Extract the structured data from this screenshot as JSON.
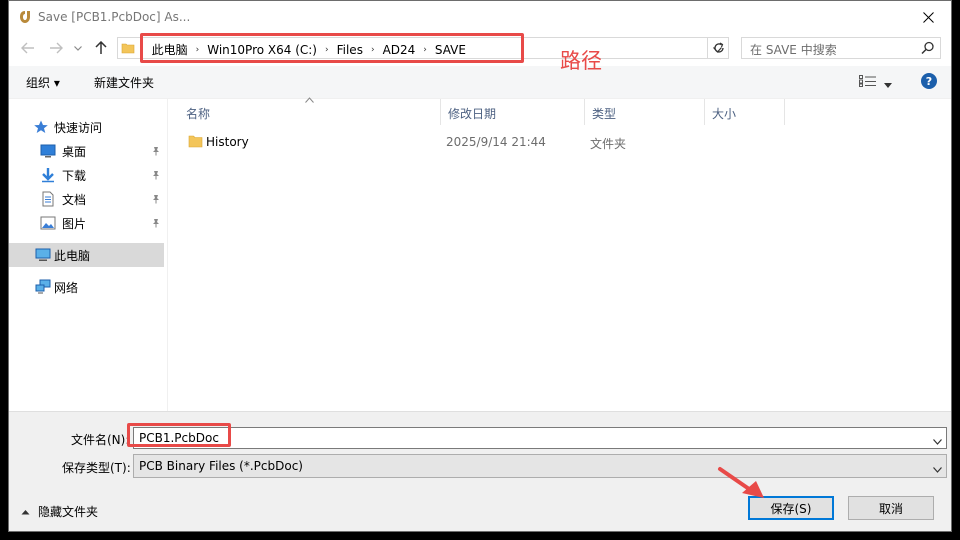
{
  "window": {
    "title": "Save [PCB1.PcbDoc] As..."
  },
  "address_bar": {
    "crumbs": [
      "此电脑",
      "Win10Pro X64 (C:)",
      "Files",
      "AD24",
      "SAVE"
    ]
  },
  "search": {
    "placeholder": "在 SAVE 中搜索"
  },
  "annotation": {
    "path_label": "路径"
  },
  "toolbar": {
    "organize_label": "组织 ▾",
    "new_folder_label": "新建文件夹"
  },
  "sidebar": {
    "items": [
      {
        "label": "快速访问",
        "icon": "star-icon"
      },
      {
        "label": "桌面",
        "icon": "desktop-icon",
        "pinned": true
      },
      {
        "label": "下载",
        "icon": "download-icon",
        "pinned": true
      },
      {
        "label": "文档",
        "icon": "document-icon",
        "pinned": true
      },
      {
        "label": "图片",
        "icon": "pictures-icon",
        "pinned": true
      },
      {
        "label": "此电脑",
        "icon": "computer-icon",
        "selected": true
      },
      {
        "label": "网络",
        "icon": "network-icon"
      }
    ]
  },
  "columns": {
    "name": "名称",
    "date": "修改日期",
    "type": "类型",
    "size": "大小"
  },
  "files": [
    {
      "name": "History",
      "date": "2025/9/14 21:44",
      "type": "文件夹",
      "size": ""
    }
  ],
  "form": {
    "filename_label": "文件名(N):",
    "filename_value": "PCB1.PcbDoc",
    "filetype_label": "保存类型(T):",
    "filetype_value": "PCB Binary Files (*.PcbDoc)",
    "hide_folders_label": "隐藏文件夹",
    "save_label": "保存(S)",
    "cancel_label": "取消"
  },
  "colors": {
    "annotation": "#e84a48",
    "accent": "#0078d7",
    "folder": "#f3c55a"
  }
}
